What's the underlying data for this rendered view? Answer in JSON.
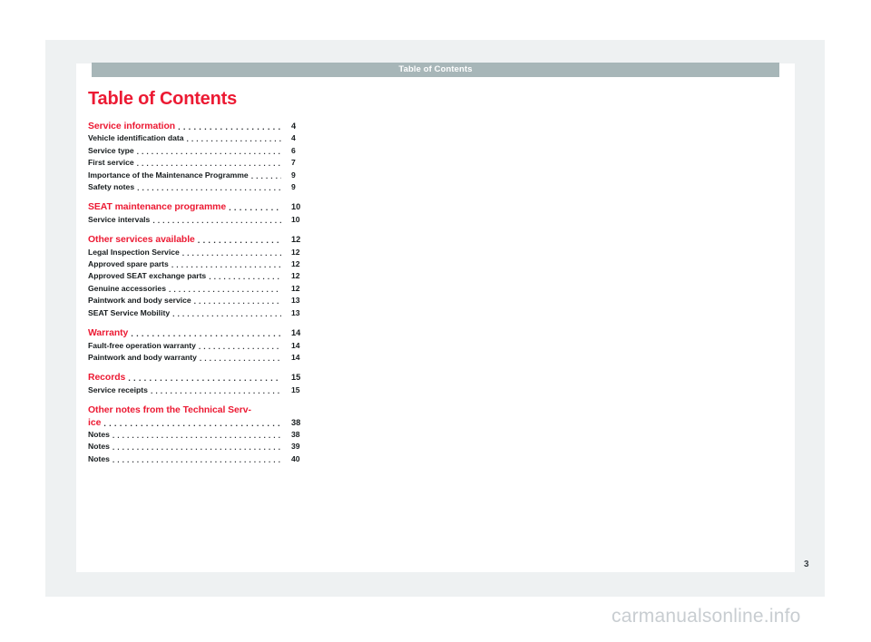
{
  "running_header": {
    "text": "Table of Contents"
  },
  "document": {
    "title": "Table of Contents",
    "folio": "3",
    "watermark": "carmanualsonline.info"
  },
  "colors": {
    "accent_red": "#ec1a33",
    "header_bar": "#a7b6b8",
    "mat": "#eef1f2",
    "paper": "#ffffff",
    "text": "#161b1d",
    "folio": "#3c4348",
    "watermark": "#c8cdd1"
  },
  "toc": {
    "groups": [
      {
        "rows": [
          {
            "label": "Service information",
            "page": "4",
            "kind": "chapter"
          },
          {
            "label": "Vehicle identification data",
            "page": "4",
            "kind": "entry"
          },
          {
            "label": "Service type",
            "page": "6",
            "kind": "entry"
          },
          {
            "label": "First service",
            "page": "7",
            "kind": "entry"
          },
          {
            "label": "Importance of the Maintenance Programme",
            "page": "9",
            "kind": "entry"
          },
          {
            "label": "Safety notes",
            "page": "9",
            "kind": "entry"
          }
        ]
      },
      {
        "rows": [
          {
            "label": "SEAT maintenance programme",
            "page": "10",
            "kind": "chapter"
          },
          {
            "label": "Service intervals",
            "page": "10",
            "kind": "entry"
          }
        ]
      },
      {
        "rows": [
          {
            "label": "Other services available",
            "page": "12",
            "kind": "chapter"
          },
          {
            "label": "Legal Inspection Service",
            "page": "12",
            "kind": "entry"
          },
          {
            "label": "Approved spare parts",
            "page": "12",
            "kind": "entry"
          },
          {
            "label": "Approved SEAT exchange parts",
            "page": "12",
            "kind": "entry"
          },
          {
            "label": "Genuine accessories",
            "page": "12",
            "kind": "entry"
          },
          {
            "label": "Paintwork and body service",
            "page": "13",
            "kind": "entry"
          },
          {
            "label": "SEAT Service Mobility",
            "page": "13",
            "kind": "entry"
          }
        ]
      },
      {
        "rows": [
          {
            "label": "Warranty",
            "page": "14",
            "kind": "chapter"
          },
          {
            "label": "Fault-free operation warranty",
            "page": "14",
            "kind": "entry"
          },
          {
            "label": "Paintwork and body warranty",
            "page": "14",
            "kind": "entry"
          }
        ]
      },
      {
        "rows": [
          {
            "label": "Records",
            "page": "15",
            "kind": "chapter"
          },
          {
            "label": "Service receipts",
            "page": "15",
            "kind": "entry"
          }
        ]
      },
      {
        "rows": [
          {
            "label": "Other notes from the Technical Serv-",
            "page": "",
            "kind": "chapter-wrap-first"
          },
          {
            "label": "ice",
            "page": "38",
            "kind": "chapter-wrap-last"
          },
          {
            "label": "Notes",
            "page": "38",
            "kind": "entry"
          },
          {
            "label": "Notes",
            "page": "39",
            "kind": "entry"
          },
          {
            "label": "Notes",
            "page": "40",
            "kind": "entry"
          }
        ]
      }
    ]
  }
}
